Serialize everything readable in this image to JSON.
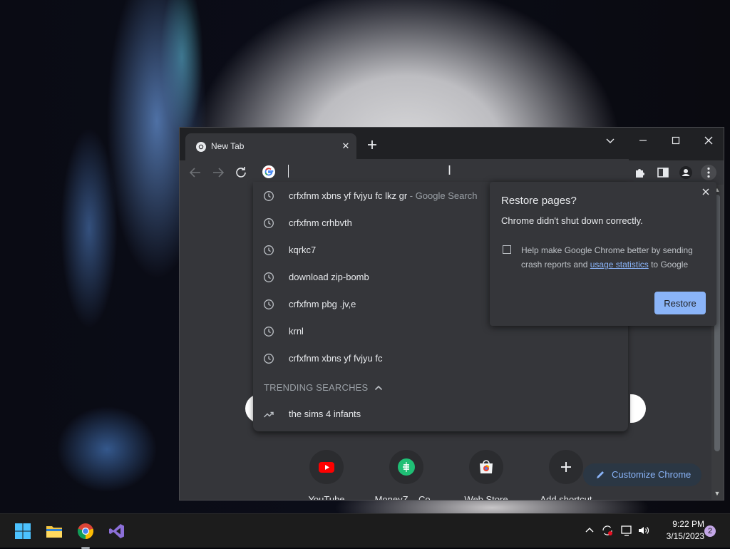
{
  "browser": {
    "tab": {
      "title": "New Tab"
    },
    "omnibox": {
      "value": ""
    }
  },
  "suggestions": [
    {
      "text": "crfxfnm xbns yf fvjyu fc lkz gr",
      "suffix": " - Google Search"
    },
    {
      "text": "crfxfnm crhbvth",
      "suffix": ""
    },
    {
      "text": "kqrkc7",
      "suffix": ""
    },
    {
      "text": "download zip-bomb",
      "suffix": ""
    },
    {
      "text": "crfxfnm pbg .jv,e",
      "suffix": ""
    },
    {
      "text": "krnl",
      "suffix": ""
    },
    {
      "text": "crfxfnm xbns yf fvjyu fc",
      "suffix": ""
    }
  ],
  "trending": {
    "header": "TRENDING SEARCHES",
    "items": [
      {
        "text": "the sims 4 infants"
      }
    ]
  },
  "restore_bubble": {
    "title": "Restore pages?",
    "message": "Chrome didn't shut down correctly.",
    "checkbox_text_before": "Help make Google Chrome better by sending crash reports and ",
    "checkbox_link": "usage statistics",
    "checkbox_text_after": " to Google",
    "button": "Restore",
    "checked": false
  },
  "shortcuts": [
    {
      "label": "YouTube",
      "icon": "youtube-icon"
    },
    {
      "label": "MoneyZ – Co...",
      "icon": "moneyz-icon"
    },
    {
      "label": "Web Store",
      "icon": "web-store-icon"
    },
    {
      "label": "Add shortcut",
      "icon": "plus-icon"
    }
  ],
  "customize": {
    "label": "Customize Chrome"
  },
  "taskbar": {
    "apps": [
      "windows-start-icon",
      "file-explorer-icon",
      "chrome-icon",
      "visual-studio-icon"
    ],
    "time": "9:22 PM",
    "date": "3/15/2023",
    "notification_count": "2"
  },
  "colors": {
    "accent": "#8ab4f8",
    "surface": "#35363a",
    "tabstrip": "#202124",
    "taskbar": "#1c1c1c"
  }
}
